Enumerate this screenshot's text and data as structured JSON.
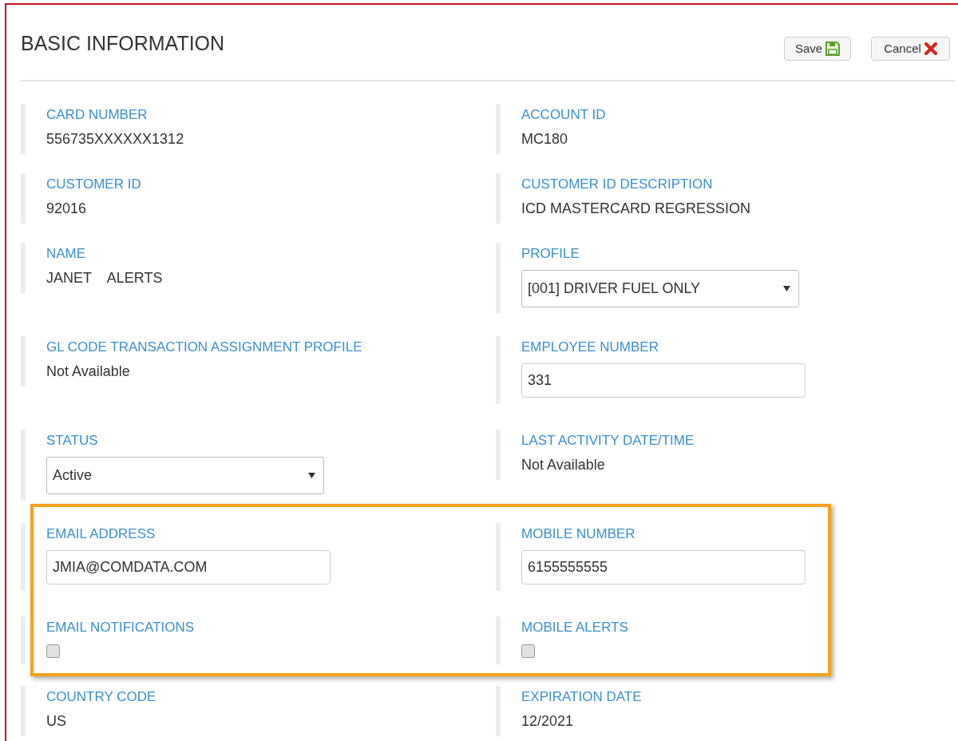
{
  "title": "BASIC INFORMATION",
  "buttons": [
    {
      "label": "Save",
      "kind": "save"
    },
    {
      "label": "Cancel",
      "kind": "cancel"
    }
  ],
  "rows": [
    {
      "highlighted": false,
      "fields": [
        {
          "label": "CARD NUMBER",
          "kind": "text",
          "value": "556735XXXXXX1312"
        },
        {
          "label": "ACCOUNT ID",
          "kind": "text",
          "value": "MC180"
        }
      ]
    },
    {
      "highlighted": false,
      "fields": [
        {
          "label": "CUSTOMER ID",
          "kind": "text",
          "value": "92016"
        },
        {
          "label": "CUSTOMER ID DESCRIPTION",
          "kind": "text",
          "value": "ICD MASTERCARD REGRESSION"
        }
      ]
    },
    {
      "highlighted": false,
      "fields": [
        {
          "label": "NAME",
          "kind": "text",
          "value": "JANET    ALERTS"
        },
        {
          "label": "PROFILE",
          "kind": "select",
          "value": "[001] DRIVER FUEL ONLY"
        }
      ]
    },
    {
      "highlighted": false,
      "fields": [
        {
          "label": "GL CODE TRANSACTION ASSIGNMENT PROFILE",
          "kind": "text",
          "value": "Not Available"
        },
        {
          "label": "EMPLOYEE NUMBER",
          "kind": "input",
          "value": "331"
        }
      ]
    },
    {
      "highlighted": false,
      "fields": [
        {
          "label": "STATUS",
          "kind": "select",
          "value": "Active"
        },
        {
          "label": "LAST ACTIVITY DATE/TIME",
          "kind": "text",
          "value": "Not Available"
        }
      ]
    },
    {
      "highlighted": true,
      "fields": [
        {
          "label": "EMAIL ADDRESS",
          "kind": "input",
          "value": "JMIA@COMDATA.COM"
        },
        {
          "label": "MOBILE NUMBER",
          "kind": "input",
          "value": "6155555555"
        }
      ]
    },
    {
      "highlighted": true,
      "fields": [
        {
          "label": "EMAIL NOTIFICATIONS",
          "kind": "checkbox",
          "checked": false
        },
        {
          "label": "MOBILE ALERTS",
          "kind": "checkbox",
          "checked": false
        }
      ]
    },
    {
      "highlighted": false,
      "fields": [
        {
          "label": "COUNTRY CODE",
          "kind": "text",
          "value": "US"
        },
        {
          "label": "EXPIRATION DATE",
          "kind": "text",
          "value": "12/2021"
        }
      ]
    }
  ]
}
